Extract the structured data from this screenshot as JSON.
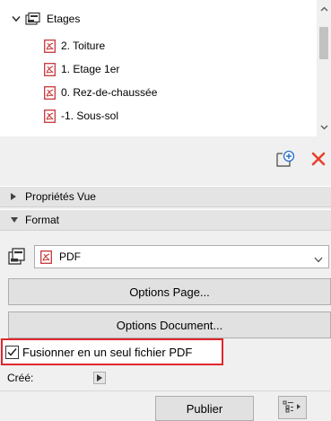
{
  "tree": {
    "root": {
      "label": "Etages"
    },
    "items": [
      {
        "label": "2. Toiture"
      },
      {
        "label": "1. Etage 1er"
      },
      {
        "label": "0. Rez-de-chaussée"
      },
      {
        "label": "-1. Sous-sol"
      }
    ]
  },
  "sections": {
    "view_properties": "Propriétés Vue",
    "format": "Format"
  },
  "format": {
    "selected": "PDF"
  },
  "buttons": {
    "page_options": "Options Page...",
    "document_options": "Options Document...",
    "publish": "Publier"
  },
  "merge": {
    "label": "Fusionner en un seul fichier PDF",
    "checked": true
  },
  "created": {
    "label": "Créé:"
  },
  "colors": {
    "pdf_icon": "#c8373a",
    "delete_icon": "#e8402a",
    "highlight": "#e0262d",
    "section_bg": "#e4e4e4"
  },
  "icons": [
    "folder-set-icon",
    "pdf-file-icon",
    "new-subset-icon",
    "delete-icon",
    "chevron-down-icon",
    "triangle-right-icon",
    "list-options-icon"
  ]
}
